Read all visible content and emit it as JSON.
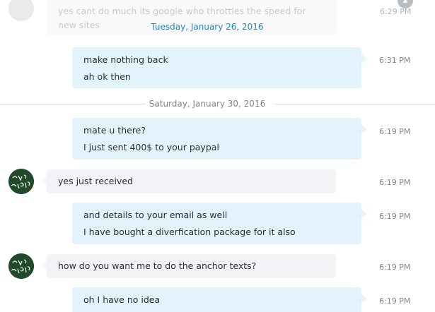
{
  "top_partial": {
    "text": "yes cant do much its google who throttles the speed for\nnew sites",
    "time": "6:29 PM",
    "floating_date": "Tuesday, January 26, 2016"
  },
  "colors": {
    "outgoing_bubble": "#e2f3fc",
    "incoming_bubble": "#f1f3f6",
    "date_accent": "#1b8ac6",
    "time_text": "#7d848a"
  },
  "messages": [
    {
      "direction": "out",
      "lines": [
        "make nothing back",
        "ah ok then"
      ],
      "time": "6:31 PM"
    },
    {
      "direction": "date",
      "label": "Saturday, January 30, 2016"
    },
    {
      "direction": "out",
      "lines": [
        "mate u there?",
        "I just sent 400$ to your paypal"
      ],
      "time": "6:19 PM"
    },
    {
      "direction": "in",
      "lines": [
        "yes just received"
      ],
      "time": "6:19 PM",
      "avatar": "chalkboard-avatar"
    },
    {
      "direction": "out",
      "lines": [
        "and details to your email as well",
        "I have bought a diverfication package for it also"
      ],
      "time": "6:19 PM"
    },
    {
      "direction": "in",
      "lines": [
        "how do you want me to do the anchor texts?"
      ],
      "time": "6:19 PM",
      "avatar": "chalkboard-avatar"
    },
    {
      "direction": "out",
      "lines": [
        "oh I have no idea"
      ],
      "time": "6:19 PM"
    }
  ]
}
